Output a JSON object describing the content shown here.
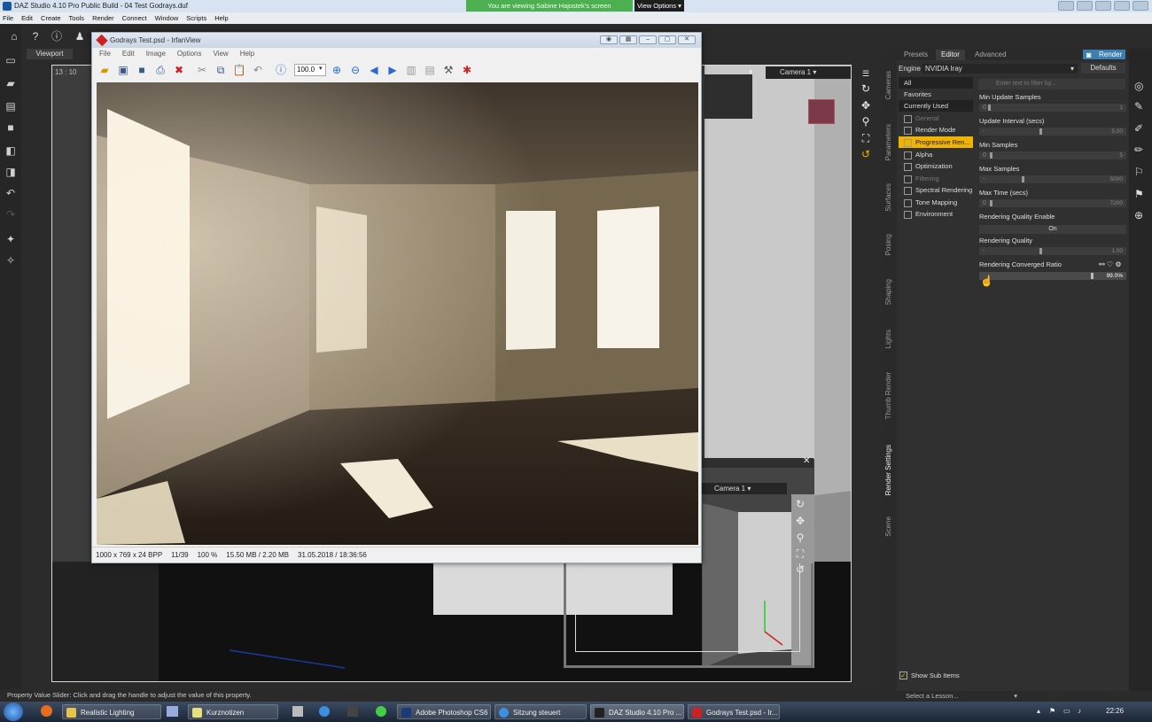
{
  "daz": {
    "title": "DAZ Studio 4.10 Pro Public Build - 04 Test Godrays.duf",
    "menu": [
      "File",
      "Edit",
      "Create",
      "Tools",
      "Render",
      "Connect",
      "Window",
      "Scripts",
      "Help"
    ]
  },
  "share": {
    "banner": "You are viewing Sabine Hajostek's screen",
    "view_options": "View Options"
  },
  "viewport": {
    "tab": "Viewport",
    "time": "13 : 10",
    "camera": "Camera 1",
    "aux_camera": "Camera 1"
  },
  "irfan": {
    "title": "Godrays Test.psd - IrfanView",
    "menu": [
      "File",
      "Edit",
      "Image",
      "Options",
      "View",
      "Help"
    ],
    "zoom": "100.0",
    "status": [
      "1000 x 769 x 24 BPP",
      "11/39",
      "100 %",
      "15.50 MB / 2.20 MB",
      "31.05.2018 / 18:36:56"
    ]
  },
  "right": {
    "tabs": [
      "Presets",
      "Editor",
      "Advanced"
    ],
    "render_button": "Render",
    "engine_label": "Engine :",
    "engine_value": "NVIDIA Iray",
    "defaults_button": "Defaults",
    "filter_placeholder": "Enter text to filter by...",
    "categories": [
      "All",
      "Favorites",
      "Currently Used",
      "General",
      "Render Mode",
      "Progressive Ren...",
      "Alpha",
      "Optimization",
      "Filtering",
      "Spectral Rendering",
      "Tone Mapping",
      "Environment"
    ],
    "properties": [
      {
        "label": "Min Update Samples",
        "min": "0",
        "value": "1"
      },
      {
        "label": "Update Interval (secs)",
        "min": "-",
        "value": "5.00"
      },
      {
        "label": "Min Samples",
        "min": "0",
        "value": "5"
      },
      {
        "label": "Max Samples",
        "min": "-",
        "value": "5000"
      },
      {
        "label": "Max Time (secs)",
        "min": "0",
        "value": "7200"
      },
      {
        "label": "Rendering Quality Enable",
        "min": "",
        "value": "On"
      },
      {
        "label": "Rendering Quality",
        "min": "-",
        "value": "1.00"
      },
      {
        "label": "Rendering Converged Ratio",
        "min": "",
        "value": "99.0%"
      }
    ],
    "vertical_tabs": [
      "Cameras",
      "Parameters",
      "Surfaces",
      "Posing",
      "Shaping",
      "Lights",
      "Thumb Render",
      "Render Settings",
      "Scene"
    ],
    "show_sub_items": "Show Sub Items",
    "lesson": "Select a Lesson..."
  },
  "status_text": "Property Value Slider: Click and drag the handle to adjust the value of this property.",
  "taskbar": {
    "items": [
      "Realistic Lighting",
      "Kurznotizen",
      "Adobe Photoshop CS6",
      "Sitzung steuert",
      "DAZ Studio 4.10 Pro ...",
      "Godrays Test.psd - Ir..."
    ],
    "clock": "22:26"
  },
  "colors": {
    "accent": "#f0b400",
    "render": "#3a7fb0",
    "share": "#4caf50"
  }
}
